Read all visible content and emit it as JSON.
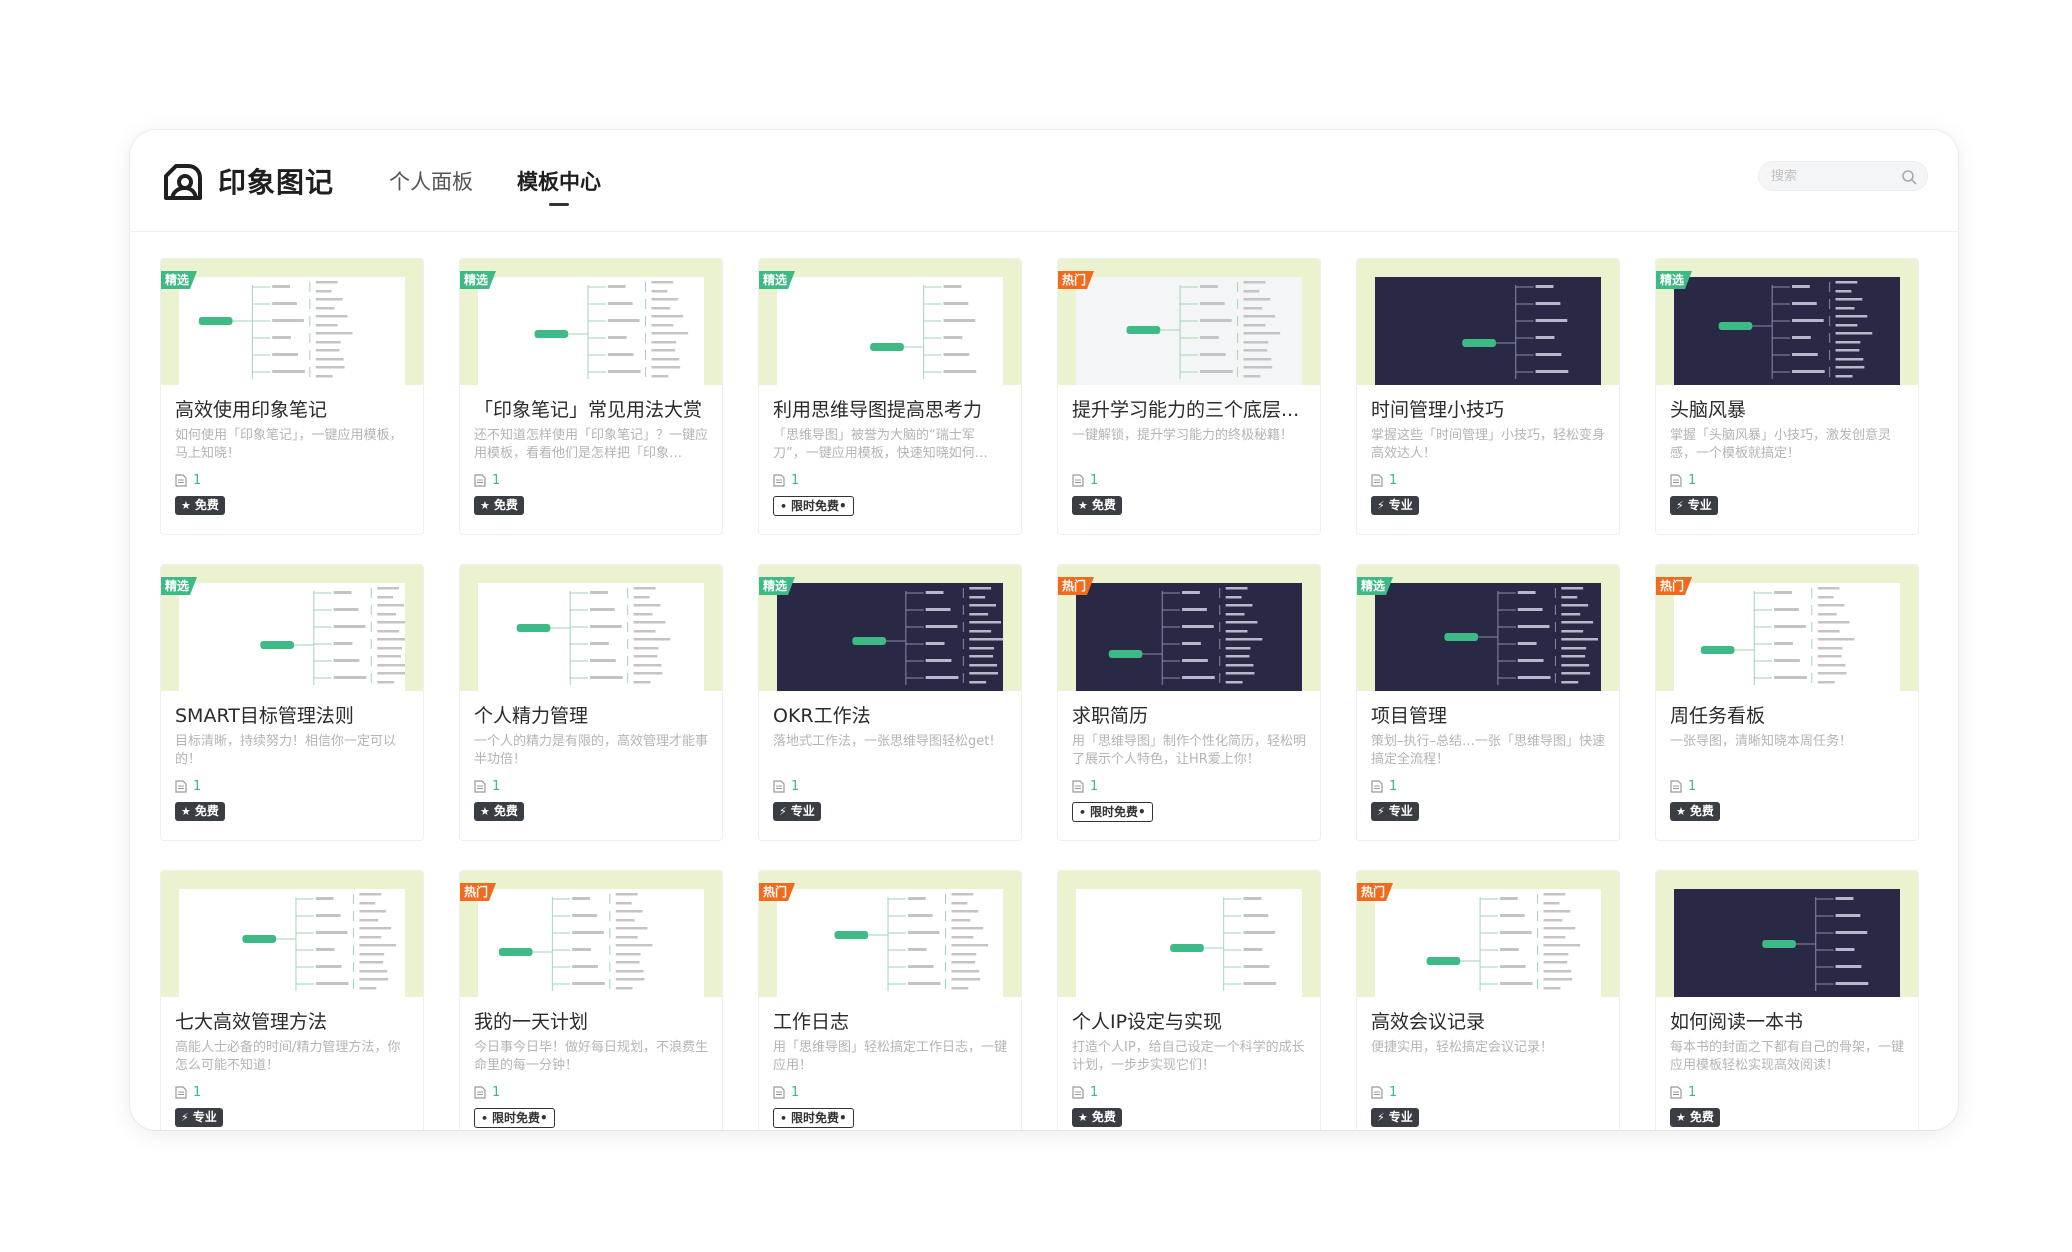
{
  "app": {
    "name": "印象图记"
  },
  "nav": [
    {
      "label": "个人面板",
      "active": false
    },
    {
      "label": "模板中心",
      "active": true
    }
  ],
  "search": {
    "placeholder": "搜索"
  },
  "badge_labels": {
    "free": "免费",
    "pro": "专业",
    "limited": "限时免费"
  },
  "corner_labels": {
    "jx": "精选",
    "rm": "热门"
  },
  "cards": [
    {
      "title": "高效使用印象笔记",
      "desc": "如何使用「印象笔记」，一键应用模板，马上知晓！",
      "count": "1",
      "corner": "jx",
      "badge": "free",
      "theme": "light"
    },
    {
      "title": "「印象笔记」常见用法大赏",
      "desc": "还不知道怎样使用「印象笔记」？一键应用模板，看看他们是怎样把「印象…",
      "count": "1",
      "corner": "jx",
      "badge": "free",
      "theme": "light"
    },
    {
      "title": "利用思维导图提高思考力",
      "desc": "「思维导图」被誉为大脑的“瑞士军刀”，一键应用模板，快速知晓如何…",
      "count": "1",
      "corner": "jx",
      "badge": "limited",
      "theme": "light"
    },
    {
      "title": "提升学习能力的三个底层...",
      "desc": "一键解锁，提升学习能力的终极秘籍！",
      "count": "1",
      "corner": "rm",
      "badge": "free",
      "theme": "gray"
    },
    {
      "title": "时间管理小技巧",
      "desc": "掌握这些「时间管理」小技巧，轻松变身高效达人！",
      "count": "1",
      "corner": "",
      "badge": "pro",
      "theme": "dark"
    },
    {
      "title": "头脑风暴",
      "desc": "掌握「头脑风暴」小技巧，激发创意灵感，一个模板就搞定！",
      "count": "1",
      "corner": "jx",
      "badge": "pro",
      "theme": "dark"
    },
    {
      "title": "SMART目标管理法则",
      "desc": "目标清晰，持续努力！相信你一定可以的！",
      "count": "1",
      "corner": "jx",
      "badge": "free",
      "theme": "light"
    },
    {
      "title": "个人精力管理",
      "desc": "一个人的精力是有限的，高效管理才能事半功倍！",
      "count": "1",
      "corner": "",
      "badge": "free",
      "theme": "light"
    },
    {
      "title": "OKR工作法",
      "desc": "落地式工作法，一张思维导图轻松get!",
      "count": "1",
      "corner": "jx",
      "badge": "pro",
      "theme": "dark"
    },
    {
      "title": "求职简历",
      "desc": "用「思维导图」制作个性化简历，轻松明了展示个人特色，让HR爱上你！",
      "count": "1",
      "corner": "rm",
      "badge": "limited",
      "theme": "dark"
    },
    {
      "title": "项目管理",
      "desc": "策划–执行–总结…一张「思维导图」快速搞定全流程！",
      "count": "1",
      "corner": "jx",
      "badge": "pro",
      "theme": "dark"
    },
    {
      "title": "周任务看板",
      "desc": "一张导图，清晰知晓本周任务！",
      "count": "1",
      "corner": "rm",
      "badge": "free",
      "theme": "light"
    },
    {
      "title": "七大高效管理方法",
      "desc": "高能人士必备的时间/精力管理方法，你怎么可能不知道！",
      "count": "1",
      "corner": "",
      "badge": "pro",
      "theme": "light"
    },
    {
      "title": "我的一天计划",
      "desc": "今日事今日毕！做好每日规划，不浪费生命里的每一分钟！",
      "count": "1",
      "corner": "rm",
      "badge": "limited",
      "theme": "light"
    },
    {
      "title": "工作日志",
      "desc": "用「思维导图」轻松搞定工作日志，一键应用！",
      "count": "1",
      "corner": "rm",
      "badge": "limited",
      "theme": "light"
    },
    {
      "title": "个人IP设定与实现",
      "desc": "打造个人IP，给自己设定一个科学的成长计划，一步步实现它们！",
      "count": "1",
      "corner": "",
      "badge": "free",
      "theme": "light"
    },
    {
      "title": "高效会议记录",
      "desc": "便捷实用，轻松搞定会议记录！",
      "count": "1",
      "corner": "rm",
      "badge": "pro",
      "theme": "light"
    },
    {
      "title": "如何阅读一本书",
      "desc": "每本书的封面之下都有自己的骨架，一键应用模板轻松实现高效阅读！",
      "count": "1",
      "corner": "",
      "badge": "free",
      "theme": "dark"
    }
  ]
}
